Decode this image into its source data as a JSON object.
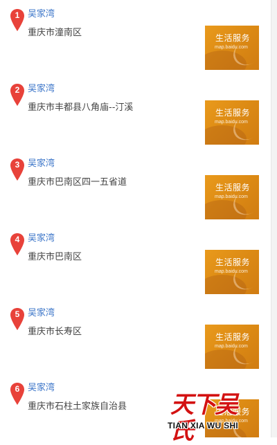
{
  "results": [
    {
      "marker": "1",
      "name": "吴家湾",
      "address": "重庆市潼南区",
      "thumb_title": "生活服务",
      "thumb_url": "map.baidu.com"
    },
    {
      "marker": "2",
      "name": "吴家湾",
      "address": "重庆市丰都县八角庙--汀溪",
      "thumb_title": "生活服务",
      "thumb_url": "map.baidu.com"
    },
    {
      "marker": "3",
      "name": "吴家湾",
      "address": "重庆市巴南区四一五省道",
      "thumb_title": "生活服务",
      "thumb_url": "map.baidu.com"
    },
    {
      "marker": "4",
      "name": "吴家湾",
      "address": "重庆市巴南区",
      "thumb_title": "生活服务",
      "thumb_url": "map.baidu.com"
    },
    {
      "marker": "5",
      "name": "吴家湾",
      "address": "重庆市长寿区",
      "thumb_title": "生活服务",
      "thumb_url": "map.baidu.com"
    },
    {
      "marker": "6",
      "name": "吴家湾",
      "address": "重庆市石柱土家族自治县",
      "thumb_title": "生活服务",
      "thumb_url": "map.baidu.com"
    }
  ],
  "watermark": {
    "chinese": "天下吴氏",
    "english": "TIAN XIA WU SHI"
  },
  "colors": {
    "marker": "#e8423a",
    "name_link": "#3a74c8",
    "address": "#444444",
    "thumb": "#e0901a",
    "watermark_red": "#d31212"
  }
}
